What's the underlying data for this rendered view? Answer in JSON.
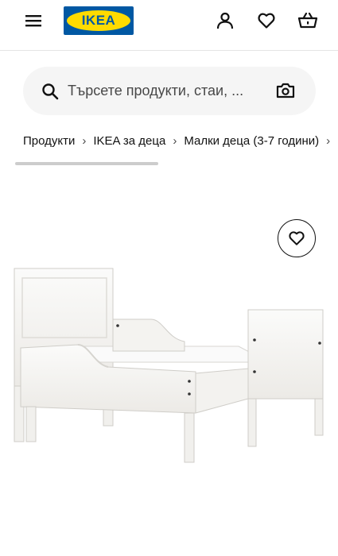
{
  "header": {
    "logo_text": "IKEA",
    "menu_icon": "hamburger-menu-icon",
    "account_icon": "user-icon",
    "wishlist_icon": "heart-icon",
    "cart_icon": "shopping-bag-icon"
  },
  "search": {
    "placeholder": "Търсете продукти, стаи, ...",
    "value": "",
    "icon": "search-icon",
    "camera_icon": "camera-icon"
  },
  "breadcrumb": {
    "items": [
      {
        "label": "Продукти"
      },
      {
        "label": "IKEA за деца"
      },
      {
        "label": "Малки деца (3-7 години)"
      }
    ],
    "separator": "›"
  },
  "product": {
    "favorite_icon": "heart-outline-icon",
    "image_subject": "white extendable toddler bed with headboard, footboard and side guard rail"
  },
  "colors": {
    "ikea_blue": "#0058a3",
    "ikea_yellow": "#ffdb00",
    "search_bg": "#f5f5f5",
    "text": "#111111"
  }
}
